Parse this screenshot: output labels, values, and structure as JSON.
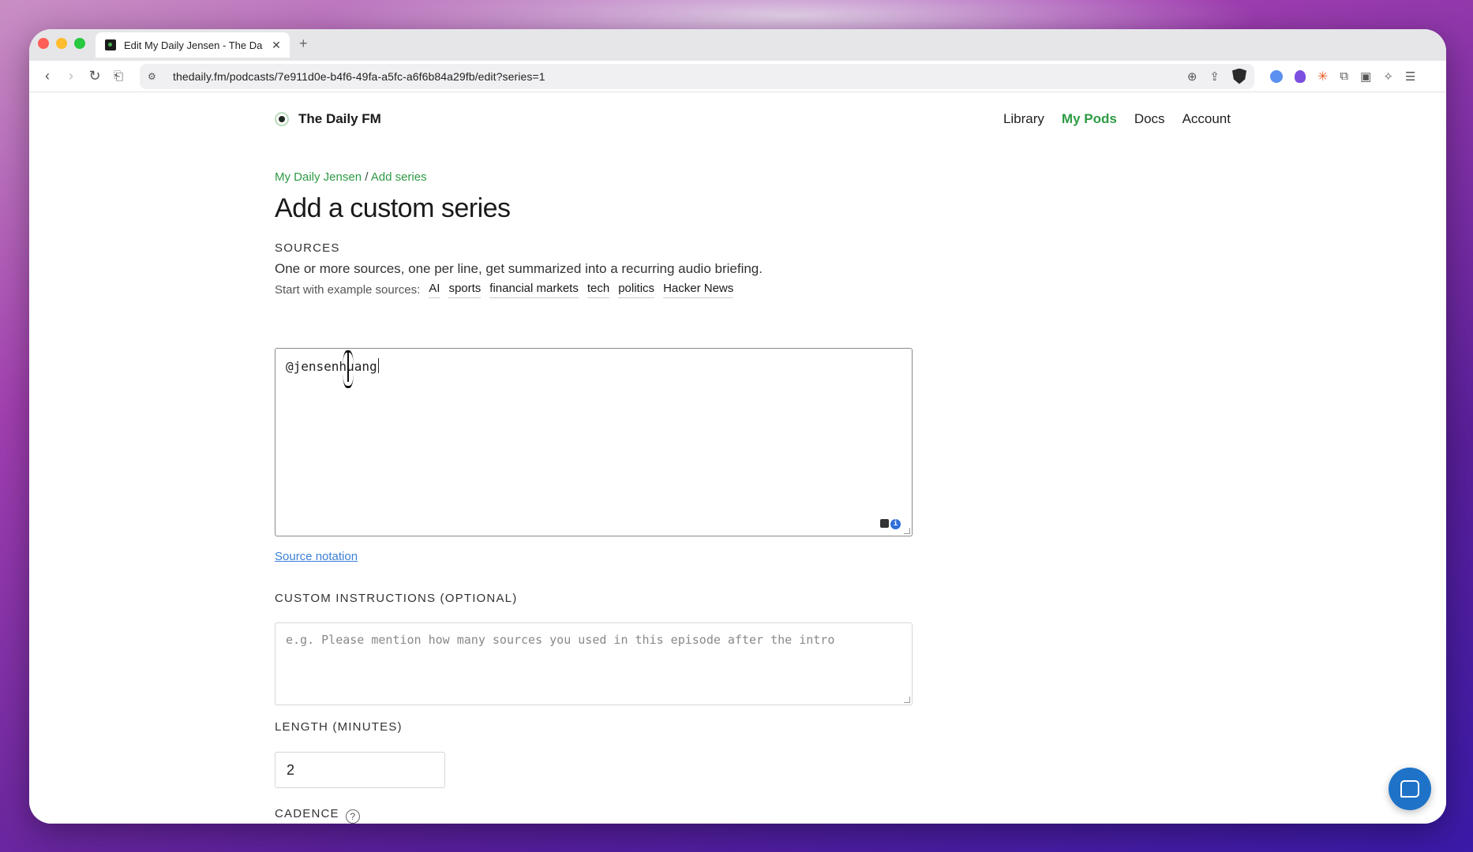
{
  "browser": {
    "tab_title": "Edit My Daily Jensen - The Da",
    "new_tab": "+",
    "url": "thedaily.fm/podcasts/7e911d0e-b4f6-49fa-a5fc-a6f6b84a29fb/edit?series=1"
  },
  "site": {
    "logo_text": "The Daily FM",
    "nav": [
      "Library",
      "My Pods",
      "Docs",
      "Account"
    ],
    "active_nav": "My Pods",
    "accent_color": "#2e9a44"
  },
  "breadcrumb": {
    "parent": "My Daily Jensen",
    "separator": "/",
    "current": "Add series"
  },
  "page_title": "Add a custom series",
  "sources": {
    "label": "SOURCES",
    "description": "One or more sources, one per line, get summarized into a recurring audio briefing.",
    "examples_label": "Start with example sources:",
    "examples": [
      "AI",
      "sports",
      "financial markets",
      "tech",
      "politics",
      "Hacker News"
    ],
    "value": "@jensenhuang",
    "notation_link": "Source notation"
  },
  "instructions": {
    "label": "CUSTOM INSTRUCTIONS (OPTIONAL)",
    "placeholder": "e.g. Please mention how many sources you used in this episode after the intro"
  },
  "length": {
    "label": "LENGTH (MINUTES)",
    "value": "2"
  },
  "cadence": {
    "label": "CADENCE",
    "help": "?"
  }
}
